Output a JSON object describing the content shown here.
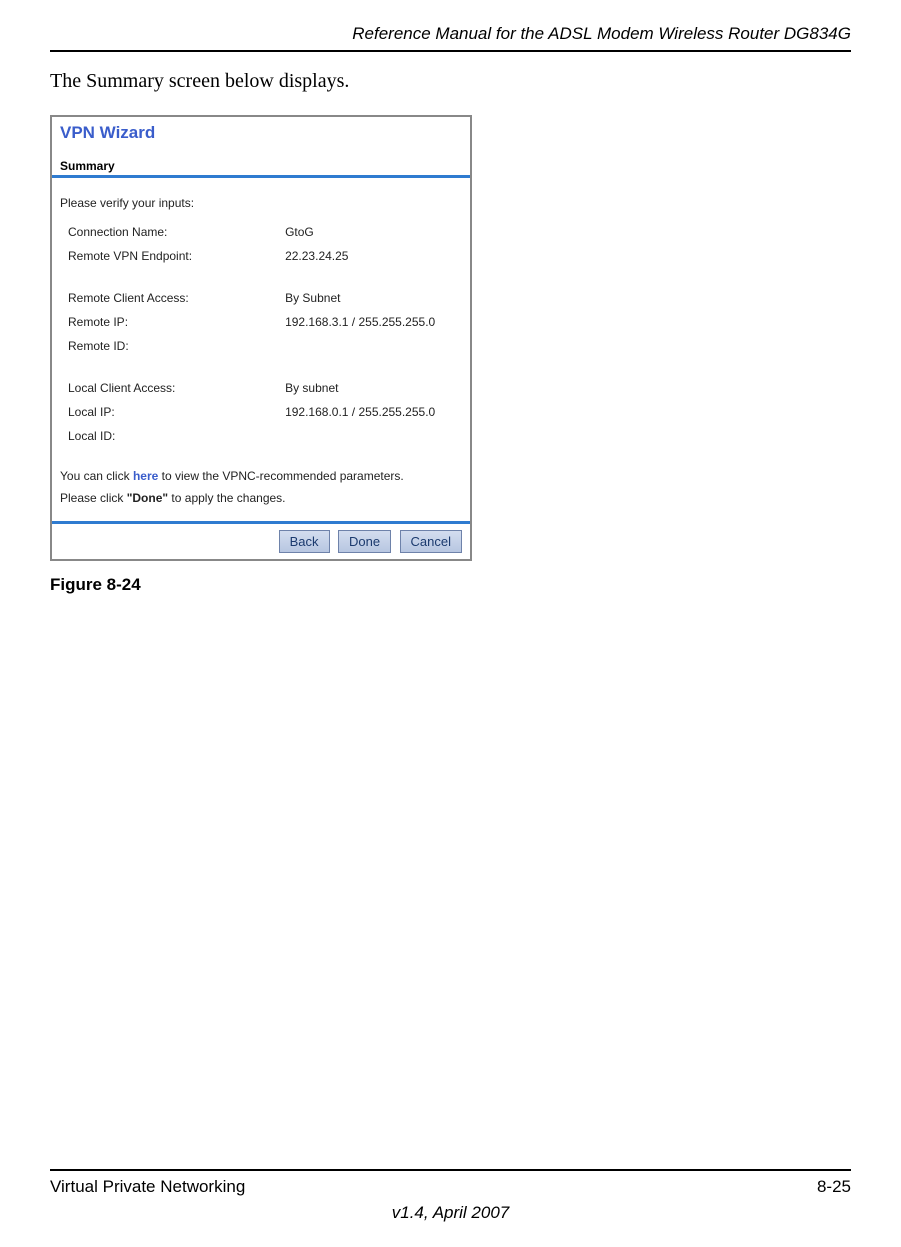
{
  "header": {
    "running_title": "Reference Manual for the ADSL Modem Wireless Router DG834G"
  },
  "intro": "The Summary screen below displays.",
  "screenshot": {
    "wizard_title": "VPN Wizard",
    "section_title": "Summary",
    "verify_text": "Please verify your inputs:",
    "rows": [
      {
        "label": "Connection Name:",
        "value": "GtoG"
      },
      {
        "label": "Remote VPN Endpoint:",
        "value": "22.23.24.25"
      },
      {
        "label": "Remote Client Access:",
        "value": "By Subnet"
      },
      {
        "label": "Remote IP:",
        "value": "192.168.3.1 / 255.255.255.0"
      },
      {
        "label": "Remote ID:",
        "value": ""
      },
      {
        "label": "Local Client Access:",
        "value": "By subnet"
      },
      {
        "label": "Local IP:",
        "value": "192.168.0.1 / 255.255.255.0"
      },
      {
        "label": "Local ID:",
        "value": ""
      }
    ],
    "hint1_pre": "You can click ",
    "hint1_link": "here",
    "hint1_post": " to view the VPNC-recommended parameters.",
    "hint2_pre": "Please click ",
    "hint2_bold": "\"Done\"",
    "hint2_post": " to apply the changes.",
    "buttons": {
      "back": "Back",
      "done": "Done",
      "cancel": "Cancel"
    }
  },
  "figure_caption": "Figure 8-24",
  "footer": {
    "section": "Virtual Private Networking",
    "page": "8-25",
    "version": "v1.4, April 2007"
  }
}
